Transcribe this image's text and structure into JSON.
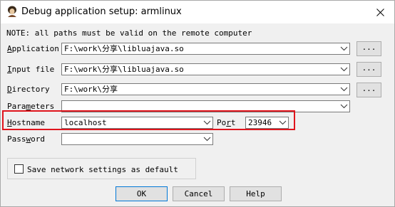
{
  "window": {
    "title": "Debug application setup: armlinux"
  },
  "note": "NOTE: all paths must be valid on the remote computer",
  "fields": {
    "application": {
      "label_prefix": "",
      "label_key": "A",
      "label_rest": "pplication",
      "value": "F:\\work\\分享\\libluajava.so"
    },
    "input_file": {
      "label_prefix": "",
      "label_key": "I",
      "label_rest": "nput file",
      "value": "F:\\work\\分享\\libluajava.so"
    },
    "directory": {
      "label_prefix": "",
      "label_key": "D",
      "label_rest": "irectory",
      "value": "F:\\work\\分享"
    },
    "parameters": {
      "label_prefix": "Para",
      "label_key": "m",
      "label_rest": "eters",
      "value": ""
    },
    "hostname": {
      "label_prefix": "",
      "label_key": "H",
      "label_rest": "ostname",
      "value": "localhost"
    },
    "port": {
      "label_prefix": "Po",
      "label_key": "r",
      "label_rest": "t",
      "value": "23946"
    },
    "password": {
      "label_prefix": "Pass",
      "label_key": "w",
      "label_rest": "ord",
      "value": ""
    }
  },
  "browse_label": "...",
  "save_settings": {
    "label": "Save network settings as default",
    "checked": false
  },
  "buttons": {
    "ok": "OK",
    "cancel": "Cancel",
    "help": "Help"
  },
  "colors": {
    "highlight": "#e0141c",
    "default_button_border": "#0078d7"
  }
}
